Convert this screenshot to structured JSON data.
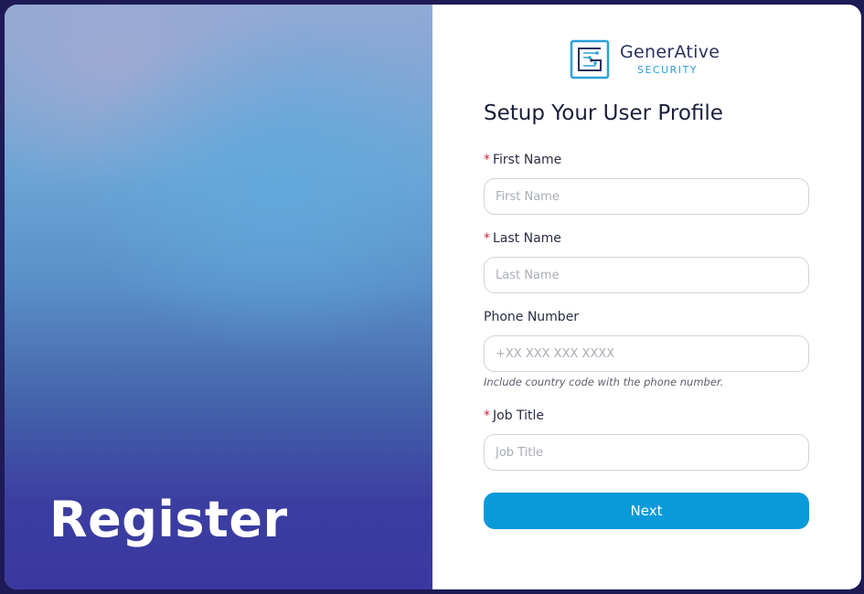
{
  "hero": {
    "title": "Register"
  },
  "logo": {
    "name": "GenerAtive",
    "subtitle": "SECURITY",
    "icon": "circuit-g-logo"
  },
  "form": {
    "title": "Setup Your User Profile",
    "required_marker": "*",
    "first_name": {
      "label": "First Name",
      "placeholder": "First Name",
      "value": ""
    },
    "last_name": {
      "label": "Last Name",
      "placeholder": "Last Name",
      "value": ""
    },
    "phone": {
      "label": "Phone Number",
      "placeholder": "+XX XXX XXX XXXX",
      "value": "",
      "hint": "Include country code with the phone number."
    },
    "job_title": {
      "label": "Job Title",
      "placeholder": "Job Title",
      "value": ""
    },
    "next_label": "Next"
  },
  "colors": {
    "accent": "#0a9ad9",
    "required": "#d81f3c",
    "title": "#1c1f3a"
  }
}
